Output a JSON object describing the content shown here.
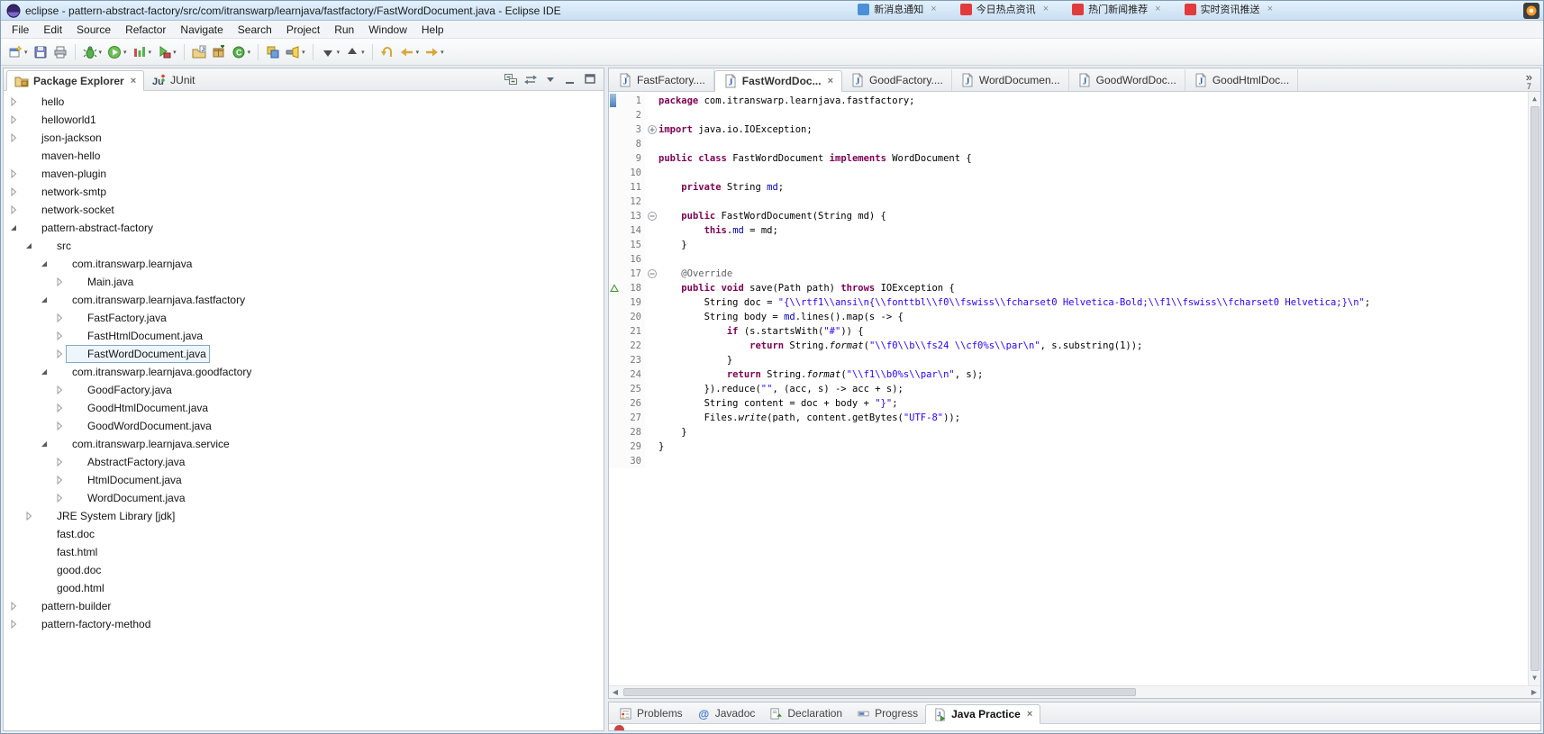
{
  "titlebar": {
    "title": "eclipse - pattern-abstract-factory/src/com/itranswarp/learnjava/fastfactory/FastWordDocument.java - Eclipse IDE",
    "notifications": [
      {
        "color": "#4a90d9",
        "label": "新消息通知"
      },
      {
        "color": "#e23b3b",
        "label": "今日热点资讯"
      },
      {
        "color": "#e23b3b",
        "label": "热门新闻推荐"
      },
      {
        "color": "#e23b3b",
        "label": "实时资讯推送"
      }
    ]
  },
  "menubar": {
    "items": [
      "File",
      "Edit",
      "Source",
      "Refactor",
      "Navigate",
      "Search",
      "Project",
      "Run",
      "Window",
      "Help"
    ]
  },
  "toolbar": {
    "buttons": [
      {
        "name": "new-wizard-button",
        "icon": "new",
        "dropdown": true
      },
      {
        "name": "save-button",
        "icon": "save"
      },
      {
        "name": "print-button",
        "icon": "print"
      },
      {
        "sep": true
      },
      {
        "name": "debug-button",
        "icon": "debug",
        "dropdown": true
      },
      {
        "name": "run-button",
        "icon": "run",
        "dropdown": true
      },
      {
        "name": "coverage-button",
        "icon": "coverage",
        "dropdown": true
      },
      {
        "name": "external-tools-button",
        "icon": "external-tools",
        "dropdown": true
      },
      {
        "sep": true
      },
      {
        "name": "new-java-project-button",
        "icon": "new-project"
      },
      {
        "name": "new-package-button",
        "icon": "new-package"
      },
      {
        "name": "new-class-button",
        "icon": "new-class",
        "dropdown": true
      },
      {
        "sep": true
      },
      {
        "name": "open-type-button",
        "icon": "open-type"
      },
      {
        "name": "search-button",
        "icon": "search",
        "dropdown": true
      },
      {
        "sep": true
      },
      {
        "name": "next-annotation-button",
        "icon": "next-annotation",
        "dropdown": true
      },
      {
        "name": "previous-annotation-button",
        "icon": "prev-annotation",
        "dropdown": true
      },
      {
        "sep": true
      },
      {
        "name": "last-edit-location-button",
        "icon": "last-edit"
      },
      {
        "name": "back-button",
        "icon": "back",
        "dropdown": true
      },
      {
        "name": "forward-button",
        "icon": "forward",
        "dropdown": true
      }
    ]
  },
  "package_explorer": {
    "tab_label": "Package Explorer",
    "junit_tab_label": "JUnit",
    "toolbar_icons": [
      {
        "name": "collapse-all-button",
        "icon": "collapse-all"
      },
      {
        "name": "link-with-editor-button",
        "icon": "link-editor"
      },
      {
        "name": "view-menu-button",
        "icon": "view-menu"
      },
      {
        "name": "minimize-button",
        "icon": "minimize"
      },
      {
        "name": "maximize-button",
        "icon": "maximize"
      }
    ],
    "tree": [
      {
        "label": "hello",
        "icon": "project",
        "level": 0,
        "arrow": "collapsed"
      },
      {
        "label": "helloworld1",
        "icon": "project",
        "level": 0,
        "arrow": "collapsed"
      },
      {
        "label": "json-jackson",
        "icon": "project",
        "level": 0,
        "arrow": "collapsed"
      },
      {
        "label": "maven-hello",
        "icon": "folder",
        "level": 0,
        "arrow": "none"
      },
      {
        "label": "maven-plugin",
        "icon": "project",
        "level": 0,
        "arrow": "collapsed"
      },
      {
        "label": "network-smtp",
        "icon": "project",
        "level": 0,
        "arrow": "collapsed"
      },
      {
        "label": "network-socket",
        "icon": "project",
        "level": 0,
        "arrow": "collapsed"
      },
      {
        "label": "pattern-abstract-factory",
        "icon": "project",
        "level": 0,
        "arrow": "expanded"
      },
      {
        "label": "src",
        "icon": "src",
        "level": 1,
        "arrow": "expanded"
      },
      {
        "label": "com.itranswarp.learnjava",
        "icon": "package",
        "level": 2,
        "arrow": "expanded"
      },
      {
        "label": "Main.java",
        "icon": "javafile",
        "level": 3,
        "arrow": "collapsed"
      },
      {
        "label": "com.itranswarp.learnjava.fastfactory",
        "icon": "package",
        "level": 2,
        "arrow": "expanded"
      },
      {
        "label": "FastFactory.java",
        "icon": "javafile",
        "level": 3,
        "arrow": "collapsed"
      },
      {
        "label": "FastHtmlDocument.java",
        "icon": "javafile",
        "level": 3,
        "arrow": "collapsed"
      },
      {
        "label": "FastWordDocument.java",
        "icon": "javafile",
        "level": 3,
        "arrow": "collapsed",
        "selected": true
      },
      {
        "label": "com.itranswarp.learnjava.goodfactory",
        "icon": "package",
        "level": 2,
        "arrow": "expanded"
      },
      {
        "label": "GoodFactory.java",
        "icon": "javafile",
        "level": 3,
        "arrow": "collapsed"
      },
      {
        "label": "GoodHtmlDocument.java",
        "icon": "javafile",
        "level": 3,
        "arrow": "collapsed"
      },
      {
        "label": "GoodWordDocument.java",
        "icon": "javafile",
        "level": 3,
        "arrow": "collapsed"
      },
      {
        "label": "com.itranswarp.learnjava.service",
        "icon": "package",
        "level": 2,
        "arrow": "expanded"
      },
      {
        "label": "AbstractFactory.java",
        "icon": "javafile",
        "level": 3,
        "arrow": "collapsed"
      },
      {
        "label": "HtmlDocument.java",
        "icon": "javafile",
        "level": 3,
        "arrow": "collapsed"
      },
      {
        "label": "WordDocument.java",
        "icon": "javafile",
        "level": 3,
        "arrow": "collapsed"
      },
      {
        "label": "JRE System Library [jdk]",
        "icon": "jre",
        "level": 1,
        "arrow": "collapsed"
      },
      {
        "label": "fast.doc",
        "icon": "docfile",
        "level": 1,
        "arrow": "none"
      },
      {
        "label": "fast.html",
        "icon": "htmlfile",
        "level": 1,
        "arrow": "none"
      },
      {
        "label": "good.doc",
        "icon": "docfile",
        "level": 1,
        "arrow": "none"
      },
      {
        "label": "good.html",
        "icon": "htmlfile",
        "level": 1,
        "arrow": "none"
      },
      {
        "label": "pattern-builder",
        "icon": "project",
        "level": 0,
        "arrow": "collapsed"
      },
      {
        "label": "pattern-factory-method",
        "icon": "project",
        "level": 0,
        "arrow": "collapsed"
      }
    ]
  },
  "editor": {
    "tabs": [
      {
        "label": "FastFactory...."
      },
      {
        "label": "FastWordDoc...",
        "active": true,
        "closable": true
      },
      {
        "label": "GoodFactory...."
      },
      {
        "label": "WordDocumen..."
      },
      {
        "label": "GoodWordDoc..."
      },
      {
        "label": "GoodHtmlDoc..."
      }
    ],
    "overflow": {
      "chevron": "»",
      "count": "7"
    },
    "code_lines": [
      {
        "n": 1,
        "marker": "range",
        "segs": [
          [
            "k",
            "package"
          ],
          [
            "p",
            " com.itranswarp.learnjava.fastfactory;"
          ]
        ]
      },
      {
        "n": 2,
        "segs": []
      },
      {
        "n": 3,
        "fold": "plus",
        "segs": [
          [
            "k",
            "import"
          ],
          [
            "p",
            " java.io.IOException;"
          ]
        ]
      },
      {
        "n": 8,
        "segs": []
      },
      {
        "n": 9,
        "segs": [
          [
            "k",
            "public"
          ],
          [
            "p",
            " "
          ],
          [
            "k",
            "class"
          ],
          [
            "p",
            " FastWordDocument "
          ],
          [
            "k",
            "implements"
          ],
          [
            "p",
            " WordDocument {"
          ]
        ]
      },
      {
        "n": 10,
        "segs": []
      },
      {
        "n": 11,
        "segs": [
          [
            "p",
            "    "
          ],
          [
            "k",
            "private"
          ],
          [
            "p",
            " String "
          ],
          [
            "f",
            "md"
          ],
          [
            "p",
            ";"
          ]
        ]
      },
      {
        "n": 12,
        "segs": []
      },
      {
        "n": 13,
        "fold": "minus",
        "segs": [
          [
            "p",
            "    "
          ],
          [
            "k",
            "public"
          ],
          [
            "p",
            " FastWordDocument(String md) {"
          ]
        ]
      },
      {
        "n": 14,
        "segs": [
          [
            "p",
            "        "
          ],
          [
            "k",
            "this"
          ],
          [
            "p",
            "."
          ],
          [
            "f",
            "md"
          ],
          [
            "p",
            " = md;"
          ]
        ]
      },
      {
        "n": 15,
        "segs": [
          [
            "p",
            "    }"
          ]
        ]
      },
      {
        "n": 16,
        "segs": []
      },
      {
        "n": 17,
        "fold": "minus",
        "segs": [
          [
            "p",
            "    "
          ],
          [
            "an",
            "@Override"
          ]
        ]
      },
      {
        "n": 18,
        "marker": "override",
        "segs": [
          [
            "p",
            "    "
          ],
          [
            "k",
            "public"
          ],
          [
            "p",
            " "
          ],
          [
            "k",
            "void"
          ],
          [
            "p",
            " save(Path path) "
          ],
          [
            "k",
            "throws"
          ],
          [
            "p",
            " IOException {"
          ]
        ]
      },
      {
        "n": 19,
        "segs": [
          [
            "p",
            "        String doc = "
          ],
          [
            "s",
            "\"{\\\\rtf1\\\\ansi\\n{\\\\fonttbl\\\\f0\\\\fswiss\\\\fcharset0 Helvetica-Bold;\\\\f1\\\\fswiss\\\\fcharset0 Helvetica;}\\n\""
          ],
          [
            "p",
            ";"
          ]
        ]
      },
      {
        "n": 20,
        "segs": [
          [
            "p",
            "        String body = "
          ],
          [
            "f",
            "md"
          ],
          [
            "p",
            ".lines().map(s -> {"
          ]
        ]
      },
      {
        "n": 21,
        "segs": [
          [
            "p",
            "            "
          ],
          [
            "k",
            "if"
          ],
          [
            "p",
            " (s.startsWith("
          ],
          [
            "s",
            "\"#\""
          ],
          [
            "p",
            ")) {"
          ]
        ]
      },
      {
        "n": 22,
        "segs": [
          [
            "p",
            "                "
          ],
          [
            "k",
            "return"
          ],
          [
            "p",
            " String."
          ],
          [
            "m",
            "format"
          ],
          [
            "p",
            "("
          ],
          [
            "s",
            "\"\\\\f0\\\\b\\\\fs24 \\\\cf0%s\\\\par\\n\""
          ],
          [
            "p",
            ", s.substring(1));"
          ]
        ]
      },
      {
        "n": 23,
        "segs": [
          [
            "p",
            "            }"
          ]
        ]
      },
      {
        "n": 24,
        "segs": [
          [
            "p",
            "            "
          ],
          [
            "k",
            "return"
          ],
          [
            "p",
            " String."
          ],
          [
            "m",
            "format"
          ],
          [
            "p",
            "("
          ],
          [
            "s",
            "\"\\\\f1\\\\b0%s\\\\par\\n\""
          ],
          [
            "p",
            ", s);"
          ]
        ]
      },
      {
        "n": 25,
        "segs": [
          [
            "p",
            "        }).reduce("
          ],
          [
            "s",
            "\"\""
          ],
          [
            "p",
            ", (acc, s) -> acc + s);"
          ]
        ]
      },
      {
        "n": 26,
        "segs": [
          [
            "p",
            "        String content = doc + body + "
          ],
          [
            "s",
            "\"}\""
          ],
          [
            "p",
            ";"
          ]
        ]
      },
      {
        "n": 27,
        "segs": [
          [
            "p",
            "        Files."
          ],
          [
            "m",
            "write"
          ],
          [
            "p",
            "(path, content.getBytes("
          ],
          [
            "s",
            "\"UTF-8\""
          ],
          [
            "p",
            "));"
          ]
        ]
      },
      {
        "n": 28,
        "segs": [
          [
            "p",
            "    }"
          ]
        ]
      },
      {
        "n": 29,
        "segs": [
          [
            "p",
            "}"
          ]
        ]
      },
      {
        "n": 30,
        "segs": []
      }
    ]
  },
  "bottom_panel": {
    "tabs": [
      {
        "label": "Problems",
        "icon": "problems"
      },
      {
        "label": "Javadoc",
        "icon": "javadoc"
      },
      {
        "label": "Declaration",
        "icon": "declaration"
      },
      {
        "label": "Progress",
        "icon": "progress"
      },
      {
        "label": "Java Practice",
        "icon": "java-practice",
        "active": true,
        "closable": true
      }
    ]
  }
}
